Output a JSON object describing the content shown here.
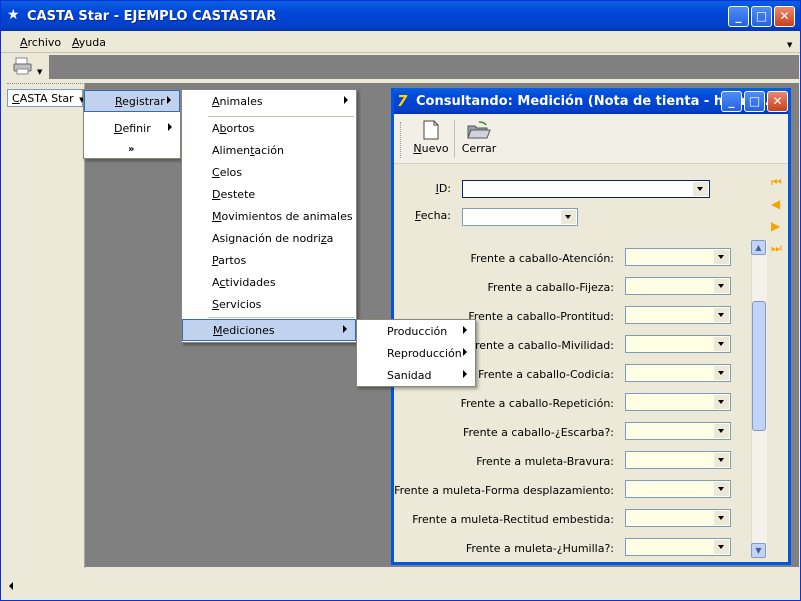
{
  "app": {
    "title": "CASTA Star - EJEMPLO CASTASTAR"
  },
  "menubar": [
    {
      "label": "Archivo",
      "u": "A",
      "rest": "rchivo"
    },
    {
      "label": "Ayuda",
      "u": "A",
      "rest": "yuda"
    }
  ],
  "left_panel": {
    "button_label": "CASTA Star",
    "button_u": "C",
    "button_rest": "ASTA Star"
  },
  "menu_level1": [
    {
      "label": "Registrar",
      "u": "R",
      "rest": "egistrar"
    },
    {
      "label": "Definir",
      "u": "D",
      "rest": "efinir"
    }
  ],
  "menu_registrar": [
    {
      "label": "Animales",
      "u": "A",
      "rest": "nimales"
    },
    {
      "label": "Abortos",
      "u": "b",
      "pre": "A",
      "rest": "ortos"
    },
    {
      "label": "Alimentación",
      "pre": "Alimen",
      "u": "t",
      "rest": "ación"
    },
    {
      "label": "Celos",
      "u": "C",
      "rest": "elos"
    },
    {
      "label": "Destete",
      "u": "D",
      "rest": "estete"
    },
    {
      "label": "Movimientos de animales",
      "u": "M",
      "rest": "ovimientos de animales"
    },
    {
      "label": "Asignación de nodriza",
      "pre": "Asignación de nodri",
      "u": "z",
      "rest": "a"
    },
    {
      "label": "Partos",
      "u": "P",
      "rest": "artos"
    },
    {
      "label": "Actividades",
      "pre": "A",
      "u": "c",
      "rest": "tividades"
    },
    {
      "label": "Servicios",
      "u": "S",
      "rest": "ervicios"
    },
    {
      "label": "Mediciones",
      "u": "M",
      "rest": "ediciones"
    }
  ],
  "menu_mediciones": [
    {
      "label": "Producción"
    },
    {
      "label": "Reproducción"
    },
    {
      "label": "Sanidad"
    }
  ],
  "child": {
    "title": "Consultando: Medición (Nota de tienta - hemb...",
    "toolbar": [
      {
        "label": "Nuevo",
        "u": "N",
        "rest": "uevo"
      },
      {
        "label": "Cerrar"
      }
    ],
    "id_label": "ID:",
    "fecha_label": "Fecha:",
    "fields": [
      "Frente a caballo-Atención:",
      "Frente a caballo-Fijeza:",
      "Frente a caballo-Prontitud:",
      "Frente a caballo-Mivilidad:",
      "Frente a caballo-Codicia:",
      "Frente a caballo-Repetición:",
      "Frente a caballo-¿Escarba?:",
      "Frente a muleta-Bravura:",
      "Frente a muleta-Forma desplazamiento:",
      "Frente a muleta-Rectitud embestida:",
      "Frente a muleta-¿Humilla?:"
    ]
  },
  "colors": {
    "titlebar": "#0046d8",
    "menu_highlight": "#c1d2ee",
    "mdi_background": "#808080",
    "nav_arrow": "#f0a800"
  }
}
